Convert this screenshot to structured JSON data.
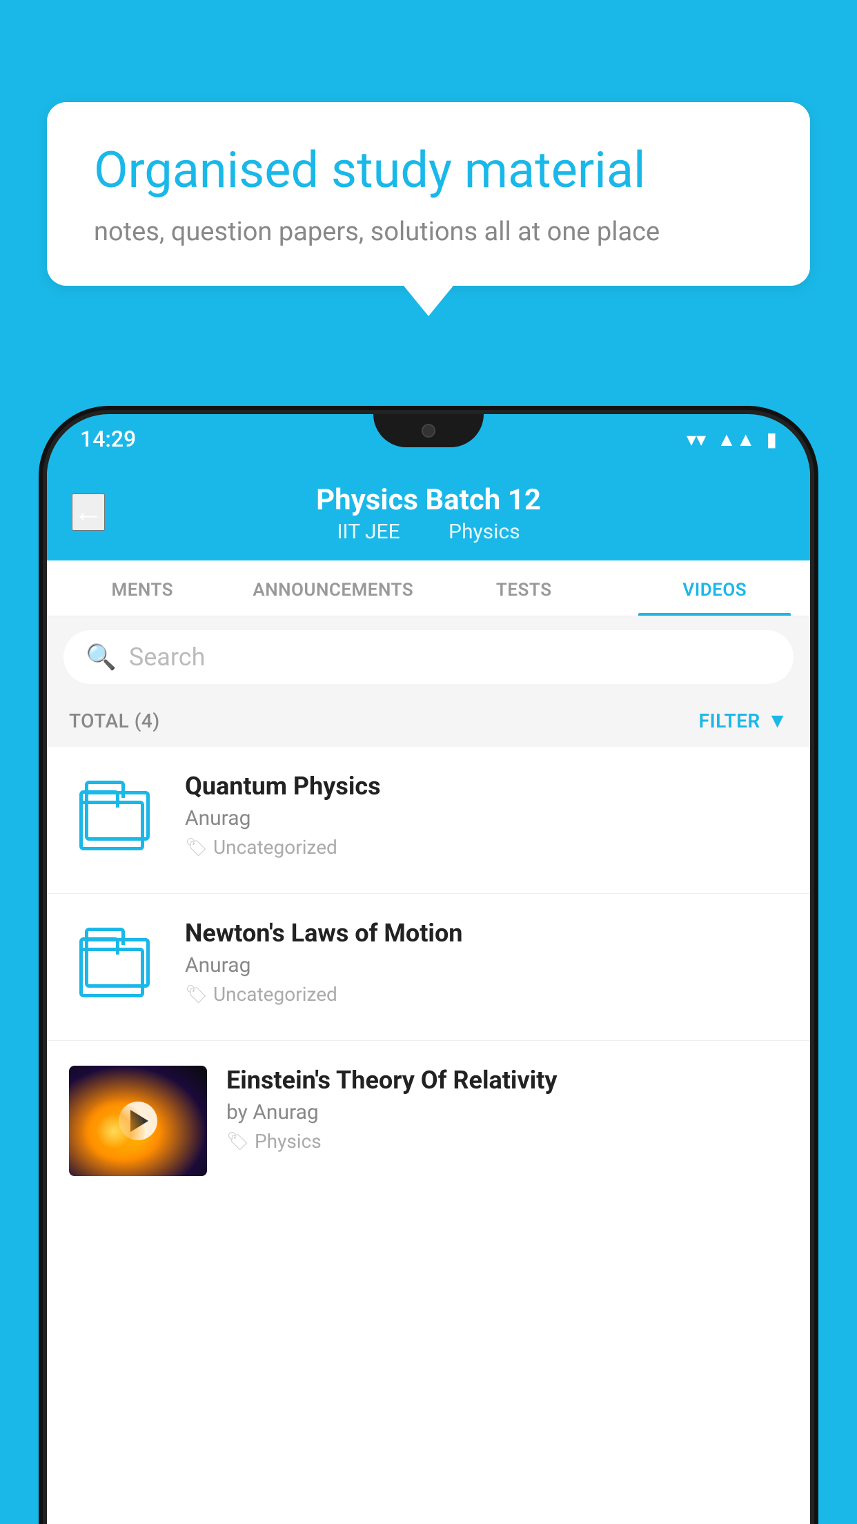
{
  "background_color": "#1ab8e8",
  "speech_bubble": {
    "title": "Organised study material",
    "subtitle": "notes, question papers, solutions all at one place"
  },
  "phone": {
    "status_bar": {
      "time": "14:29",
      "wifi": "▼",
      "signal": "▲",
      "battery": "▮"
    },
    "header": {
      "title": "Physics Batch 12",
      "subtitle1": "IIT JEE",
      "subtitle2": "Physics",
      "back_label": "←"
    },
    "tabs": [
      {
        "label": "MENTS",
        "active": false
      },
      {
        "label": "ANNOUNCEMENTS",
        "active": false
      },
      {
        "label": "TESTS",
        "active": false
      },
      {
        "label": "VIDEOS",
        "active": true
      }
    ],
    "search": {
      "placeholder": "Search"
    },
    "filter_bar": {
      "total_label": "TOTAL (4)",
      "filter_label": "FILTER"
    },
    "videos": [
      {
        "title": "Quantum Physics",
        "author": "Anurag",
        "tag": "Uncategorized",
        "type": "folder"
      },
      {
        "title": "Newton's Laws of Motion",
        "author": "Anurag",
        "tag": "Uncategorized",
        "type": "folder"
      },
      {
        "title": "Einstein's Theory Of Relativity",
        "author": "by Anurag",
        "tag": "Physics",
        "type": "video"
      }
    ]
  }
}
